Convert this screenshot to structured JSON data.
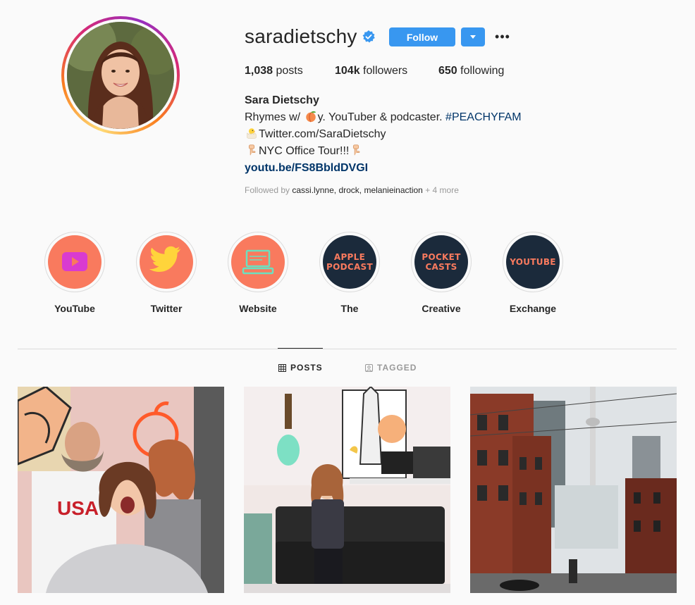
{
  "profile": {
    "username": "saradietschy",
    "verified": true,
    "follow_label": "Follow",
    "stats": {
      "posts_count": "1,038",
      "posts_label": "posts",
      "followers_count": "104k",
      "followers_label": "followers",
      "following_count": "650",
      "following_label": "following"
    },
    "bio": {
      "name": "Sara Dietschy",
      "line1_prefix": "Rhymes w/",
      "line1_suffix": "y. YouTuber & podcaster.",
      "hashtag": "#PEACHYFAM",
      "line2": "Twitter.com/SaraDietschy",
      "line3": "NYC Office Tour!!!",
      "link": "youtu.be/FS8BbldDVGI"
    },
    "followed_by": {
      "prefix": "Followed by",
      "user1": "cassi.lynne",
      "user2": "drock",
      "user3": "melanieinaction",
      "more": "+ 4 more"
    }
  },
  "highlights": [
    {
      "label": "YouTube",
      "icon": "youtube-play-icon"
    },
    {
      "label": "Twitter",
      "icon": "twitter-bird-icon"
    },
    {
      "label": "Website",
      "icon": "laptop-icon"
    },
    {
      "label": "The",
      "cover_line1": "APPLE",
      "cover_line2": "PODCAST"
    },
    {
      "label": "Creative",
      "cover_line1": "POCKET",
      "cover_line2": "CASTS"
    },
    {
      "label": "Exchange",
      "cover_line1": "YOUTUBE"
    }
  ],
  "tabs": {
    "posts": "POSTS",
    "tagged": "TAGGED"
  },
  "colors": {
    "accent": "#3897f0",
    "coral": "#f97a5e",
    "navy": "#1b2a3b",
    "link": "#003569"
  }
}
